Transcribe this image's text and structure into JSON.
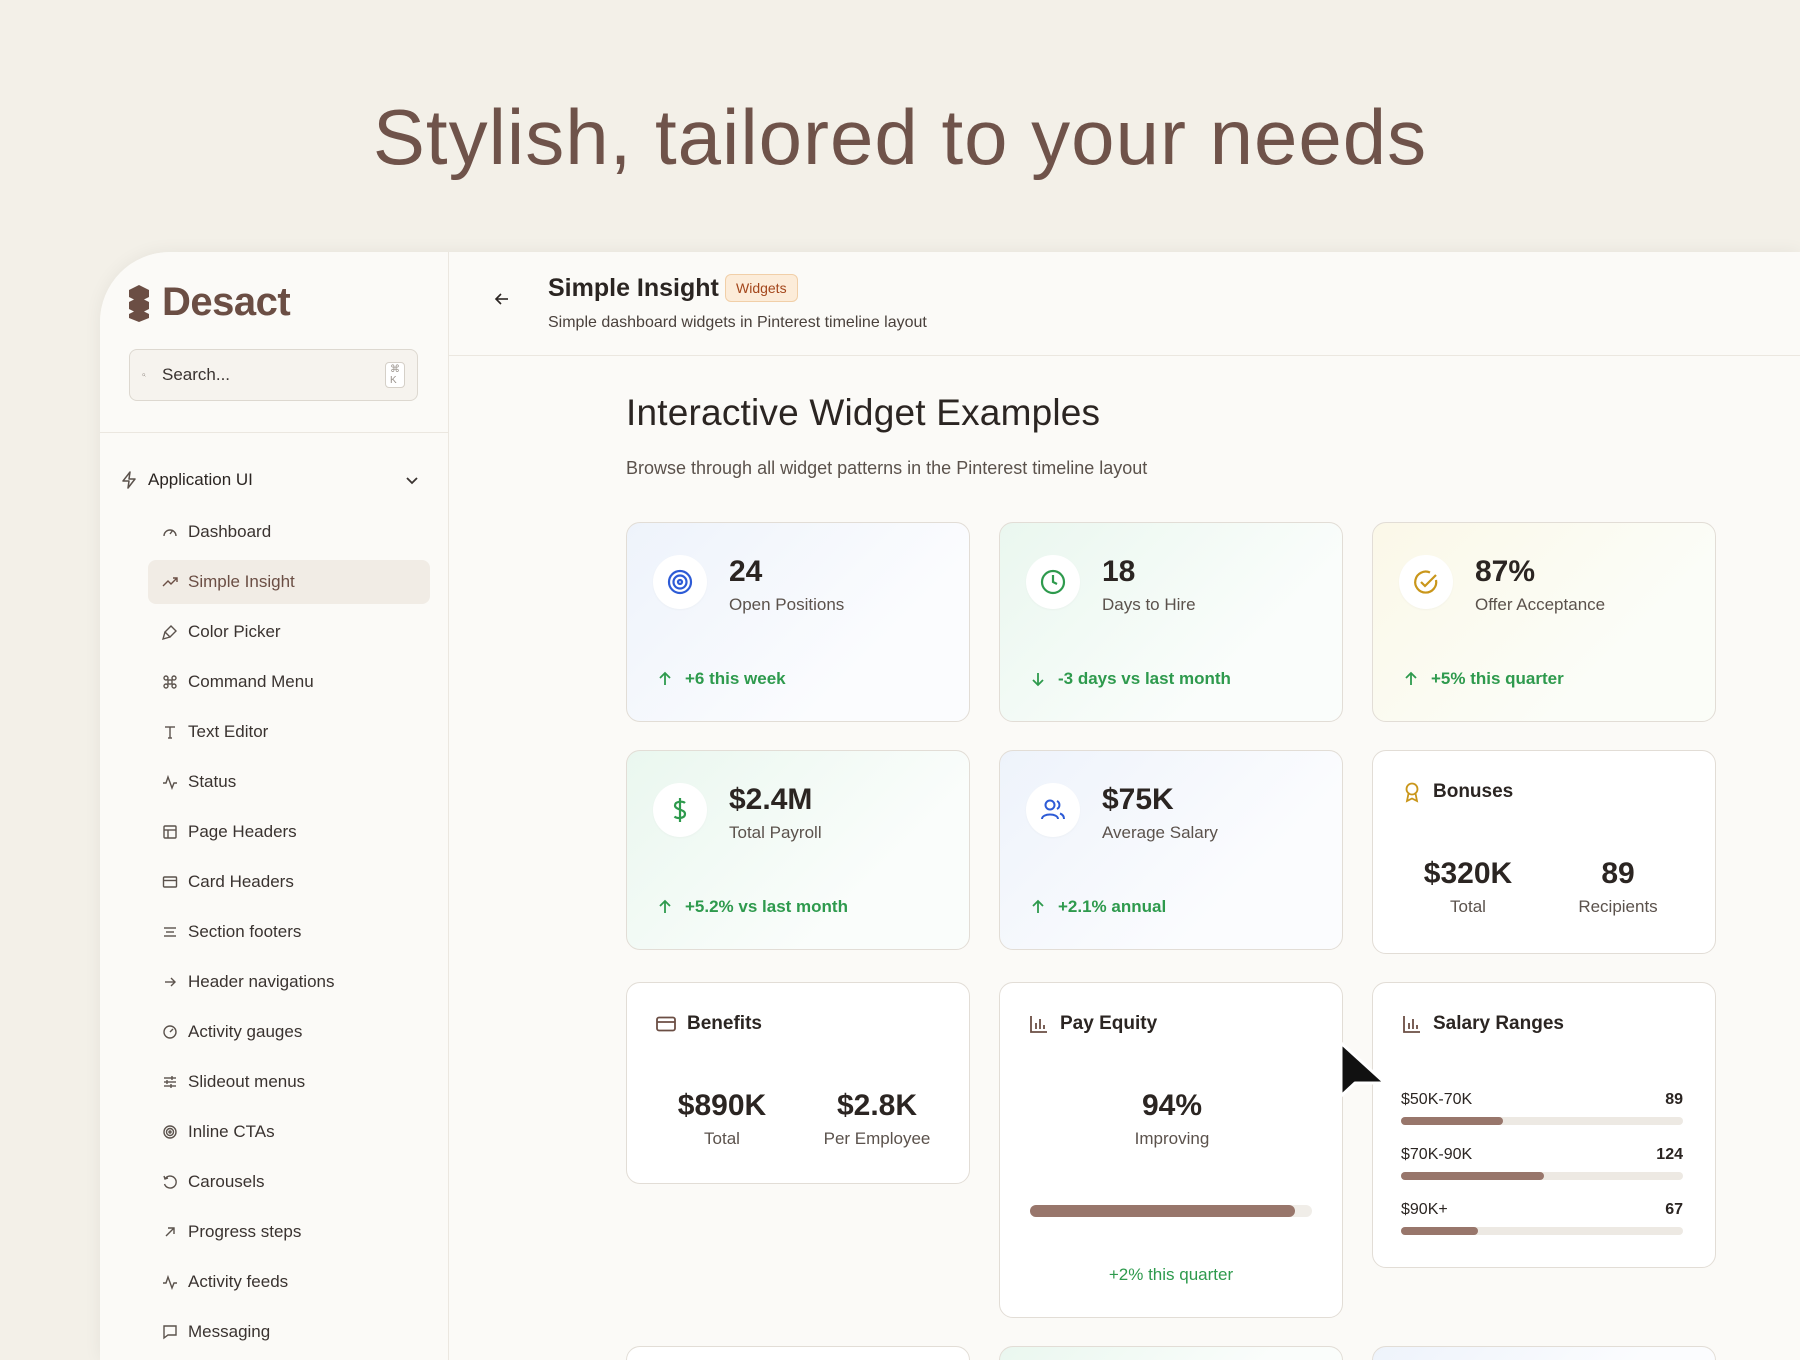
{
  "hero": {
    "headline": "Stylish, tailored to your needs"
  },
  "brand": {
    "name": "Desact",
    "color": "#6b4e44"
  },
  "search": {
    "placeholder": "Search...",
    "shortcut": "⌘ K"
  },
  "sidebar": {
    "group_label": "Application UI",
    "items": [
      {
        "label": "Dashboard",
        "icon": "gauge-icon"
      },
      {
        "label": "Simple Insight",
        "icon": "trending-up-icon",
        "active": true
      },
      {
        "label": "Color Picker",
        "icon": "brush-icon"
      },
      {
        "label": "Command Menu",
        "icon": "command-icon"
      },
      {
        "label": "Text Editor",
        "icon": "type-icon"
      },
      {
        "label": "Status",
        "icon": "activity-icon"
      },
      {
        "label": "Page Headers",
        "icon": "layout-icon"
      },
      {
        "label": "Card Headers",
        "icon": "card-icon"
      },
      {
        "label": "Section footers",
        "icon": "lines-icon"
      },
      {
        "label": "Header navigations",
        "icon": "arrow-right-icon"
      },
      {
        "label": "Activity gauges",
        "icon": "gauge-check-icon"
      },
      {
        "label": "Slideout menus",
        "icon": "sliders-icon"
      },
      {
        "label": "Inline CTAs",
        "icon": "target-icon"
      },
      {
        "label": "Carousels",
        "icon": "rotate-icon"
      },
      {
        "label": "Progress steps",
        "icon": "arrow-up-right-icon"
      },
      {
        "label": "Activity feeds",
        "icon": "activity-icon"
      },
      {
        "label": "Messaging",
        "icon": "message-icon"
      }
    ]
  },
  "header": {
    "title": "Simple Insight",
    "badge": "Widgets",
    "subtitle": "Simple dashboard widgets in Pinterest timeline layout"
  },
  "content": {
    "heading": "Interactive Widget Examples",
    "subheading": "Browse through all widget patterns in the Pinterest timeline layout"
  },
  "stats": [
    {
      "value": "24",
      "label": "Open Positions",
      "trend": "+6 this week",
      "direction": "up",
      "icon": "target-icon"
    },
    {
      "value": "18",
      "label": "Days to Hire",
      "trend": "-3 days vs last month",
      "direction": "down",
      "icon": "clock-icon"
    },
    {
      "value": "87%",
      "label": "Offer Acceptance",
      "trend": "+5% this quarter",
      "direction": "up",
      "icon": "check-circle-icon"
    },
    {
      "value": "$2.4M",
      "label": "Total Payroll",
      "trend": "+5.2% vs last month",
      "direction": "up",
      "icon": "dollar-icon"
    },
    {
      "value": "$75K",
      "label": "Average Salary",
      "trend": "+2.1% annual",
      "direction": "up",
      "icon": "users-icon"
    }
  ],
  "bonuses": {
    "title": "Bonuses",
    "total_value": "$320K",
    "total_label": "Total",
    "recipients_value": "89",
    "recipients_label": "Recipients"
  },
  "benefits": {
    "title": "Benefits",
    "total_value": "$890K",
    "total_label": "Total",
    "per_value": "$2.8K",
    "per_label": "Per Employee"
  },
  "pay_equity": {
    "title": "Pay Equity",
    "value": "94%",
    "label": "Improving",
    "progress": 0.94,
    "note": "+2% this quarter"
  },
  "salary_ranges": {
    "title": "Salary Ranges",
    "max": 245,
    "rows": [
      {
        "range": "$50K-70K",
        "count": "89",
        "value": 89
      },
      {
        "range": "$70K-90K",
        "count": "124",
        "value": 124
      },
      {
        "range": "$90K+",
        "count": "67",
        "value": 67
      }
    ]
  },
  "colors": {
    "positive": "#2e9a4d",
    "bar": "#98766b",
    "accent_badge": "#a3461b"
  }
}
